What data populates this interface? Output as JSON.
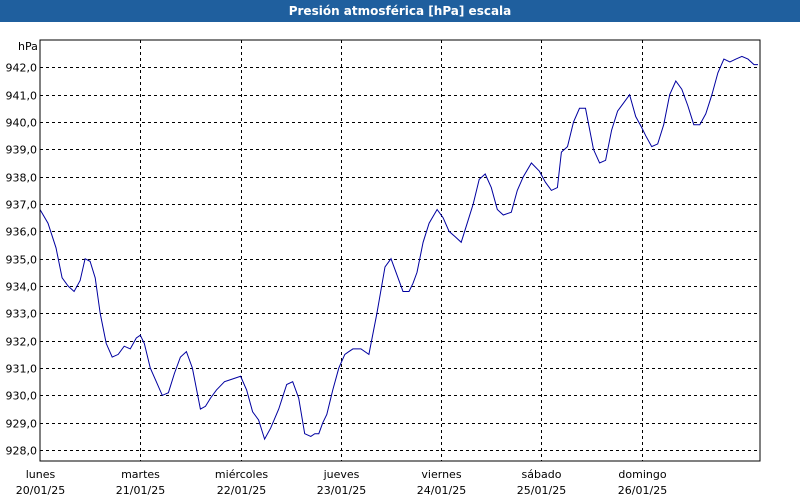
{
  "window": {
    "title": "Presión atmosférica [hPa] escala"
  },
  "colors": {
    "titlebar": "#1f5f9e",
    "line": "#0000a0",
    "grid": "#000000"
  },
  "chart_data": {
    "type": "line",
    "title": "Presión atmosférica [hPa] escala",
    "ylabel": "hPa",
    "ylim": [
      927.6,
      943.0
    ],
    "yticks": [
      928.0,
      929.0,
      930.0,
      931.0,
      932.0,
      933.0,
      934.0,
      935.0,
      936.0,
      937.0,
      938.0,
      939.0,
      940.0,
      941.0,
      942.0
    ],
    "ytick_labels": [
      "928,0",
      "929,0",
      "930,0",
      "931,0",
      "932,0",
      "933,0",
      "934,0",
      "935,0",
      "936,0",
      "937,0",
      "938,0",
      "939,0",
      "940,0",
      "941,0",
      "942,0"
    ],
    "xlim": [
      0,
      7.18
    ],
    "days": [
      {
        "day": "lunes",
        "date": "20/01/25"
      },
      {
        "day": "martes",
        "date": "21/01/25"
      },
      {
        "day": "miércoles",
        "date": "22/01/25"
      },
      {
        "day": "jueves",
        "date": "23/01/25"
      },
      {
        "day": "viernes",
        "date": "24/01/25"
      },
      {
        "day": "sábado",
        "date": "25/01/25"
      },
      {
        "day": "domingo",
        "date": "26/01/25"
      }
    ],
    "grid": true,
    "series": [
      {
        "x": [
          0,
          0.08,
          0.16,
          0.22,
          0.28,
          0.34,
          0.4,
          0.45,
          0.5,
          0.55,
          0.6,
          0.66,
          0.72,
          0.78,
          0.84,
          0.9,
          0.96,
          1.0,
          1.04,
          1.1,
          1.16,
          1.22,
          1.28,
          1.34,
          1.4,
          1.46,
          1.52,
          1.6,
          1.65,
          1.7,
          1.76,
          1.84,
          1.92,
          2.0,
          2.06,
          2.12,
          2.18,
          2.24,
          2.3,
          2.38,
          2.46,
          2.52,
          2.58,
          2.64,
          2.7,
          2.74,
          2.78,
          2.82,
          2.86,
          2.92,
          2.98,
          3.04,
          3.08,
          3.12,
          3.2,
          3.28,
          3.36,
          3.44,
          3.5,
          3.56,
          3.62,
          3.68,
          3.72,
          3.76,
          3.82,
          3.88,
          3.96,
          4.02,
          4.08,
          4.14,
          4.2,
          4.26,
          4.32,
          4.38,
          4.44,
          4.5,
          4.56,
          4.62,
          4.7,
          4.76,
          4.82,
          4.9,
          4.98,
          5.04,
          5.1,
          5.16,
          5.2,
          5.26,
          5.32,
          5.38,
          5.44,
          5.52,
          5.58,
          5.64,
          5.7,
          5.76,
          5.82,
          5.88,
          5.94,
          6.0,
          6.04,
          6.1,
          6.16,
          6.22,
          6.28,
          6.34,
          6.4,
          6.46,
          6.52,
          6.58,
          6.64,
          6.7,
          6.76,
          6.82,
          6.88,
          6.94,
          7.0,
          7.06,
          7.12,
          7.16
        ],
        "y": [
          936.8,
          936.3,
          935.4,
          934.3,
          934.0,
          933.8,
          934.2,
          935.0,
          934.9,
          934.3,
          933.0,
          931.9,
          931.4,
          931.5,
          931.8,
          931.7,
          932.1,
          932.2,
          931.9,
          931.0,
          930.5,
          930.0,
          930.1,
          930.8,
          931.4,
          931.6,
          931.0,
          929.5,
          929.6,
          929.9,
          930.2,
          930.5,
          930.6,
          930.7,
          930.2,
          929.4,
          929.1,
          928.4,
          928.8,
          929.5,
          930.4,
          930.5,
          929.9,
          928.6,
          928.5,
          928.6,
          928.6,
          929.0,
          929.3,
          930.2,
          931.0,
          931.5,
          931.6,
          931.7,
          931.7,
          931.5,
          933.0,
          934.7,
          935.0,
          934.4,
          933.8,
          933.8,
          934.1,
          934.5,
          935.6,
          936.3,
          936.8,
          936.5,
          936.0,
          935.8,
          935.6,
          936.3,
          937.0,
          937.9,
          938.1,
          937.6,
          936.8,
          936.6,
          936.7,
          937.5,
          938.0,
          938.5,
          938.2,
          937.8,
          937.5,
          937.6,
          938.9,
          939.1,
          940.0,
          940.5,
          940.5,
          939.0,
          938.5,
          938.6,
          939.7,
          940.4,
          940.7,
          941.0,
          940.2,
          939.8,
          939.5,
          939.1,
          939.2,
          939.9,
          941.0,
          941.5,
          941.2,
          940.6,
          939.9,
          939.9,
          940.3,
          941.0,
          941.8,
          942.3,
          942.2,
          942.3,
          942.4,
          942.3,
          942.1,
          942.1
        ]
      }
    ]
  }
}
